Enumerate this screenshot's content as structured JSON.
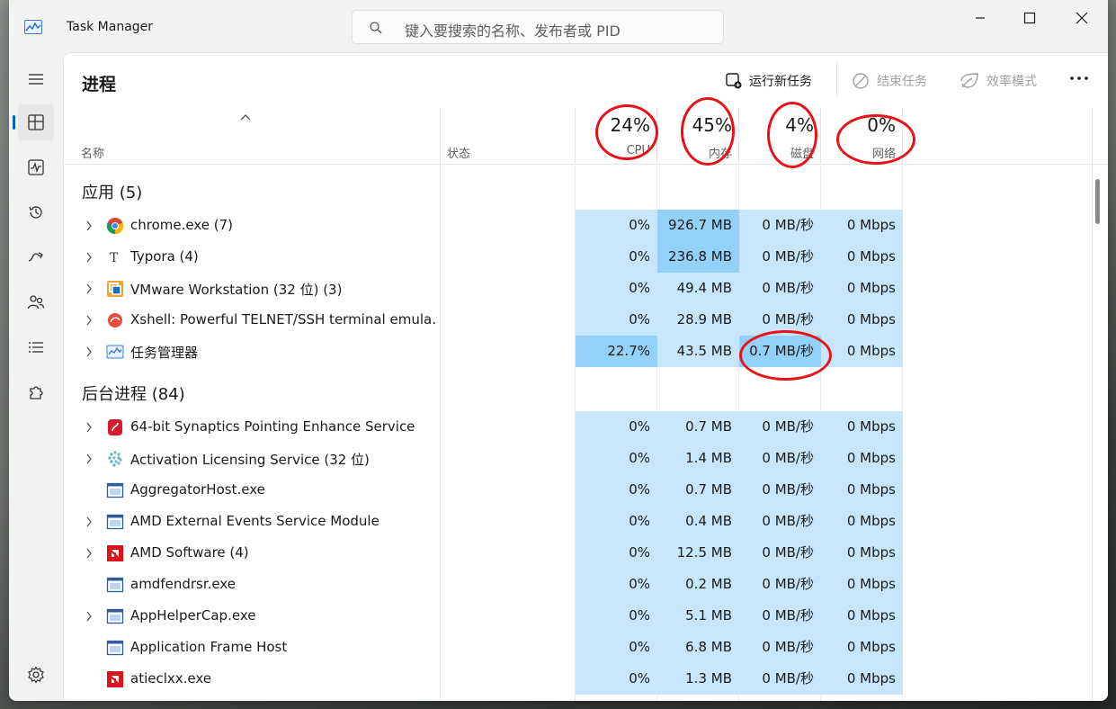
{
  "window": {
    "title": "Task Manager",
    "search_placeholder": "键入要搜索的名称、发布者或 PID"
  },
  "page": {
    "title": "进程",
    "commands": {
      "run_new_task": "运行新任务",
      "end_task": "结束任务",
      "efficiency_mode": "效率模式"
    }
  },
  "header": {
    "name": "名称",
    "status": "状态",
    "cpu_pct": "24%",
    "cpu_label": "CPU",
    "mem_pct": "45%",
    "mem_label": "内存",
    "disk_pct": "4%",
    "disk_label": "磁盘",
    "net_pct": "0%",
    "net_label": "网络"
  },
  "groups": {
    "apps": "应用 (5)",
    "background": "后台进程 (84)"
  },
  "apps": [
    {
      "name": "chrome.exe (7)",
      "icon": "chrome-icon",
      "cpu": "0%",
      "mem": "926.7 MB",
      "disk": "0 MB/秒",
      "net": "0 Mbps"
    },
    {
      "name": "Typora (4)",
      "icon": "typora-icon",
      "cpu": "0%",
      "mem": "236.8 MB",
      "disk": "0 MB/秒",
      "net": "0 Mbps"
    },
    {
      "name": "VMware Workstation (32 位) (3)",
      "icon": "vmware-icon",
      "cpu": "0%",
      "mem": "49.4 MB",
      "disk": "0 MB/秒",
      "net": "0 Mbps"
    },
    {
      "name": "Xshell: Powerful TELNET/SSH terminal emula...",
      "icon": "xshell-icon",
      "cpu": "0%",
      "mem": "28.9 MB",
      "disk": "0 MB/秒",
      "net": "0 Mbps"
    },
    {
      "name": "任务管理器",
      "icon": "task-manager-icon",
      "cpu": "22.7%",
      "mem": "43.5 MB",
      "disk": "0.7 MB/秒",
      "net": "0 Mbps"
    }
  ],
  "background": [
    {
      "name": "64-bit Synaptics Pointing Enhance Service",
      "icon": "synaptics-icon",
      "cpu": "0%",
      "mem": "0.7 MB",
      "disk": "0 MB/秒",
      "net": "0 Mbps"
    },
    {
      "name": "Activation Licensing Service (32 位)",
      "icon": "activation-icon",
      "cpu": "0%",
      "mem": "1.4 MB",
      "disk": "0 MB/秒",
      "net": "0 Mbps"
    },
    {
      "name": "AggregatorHost.exe",
      "icon": "app-window-icon",
      "cpu": "0%",
      "mem": "0.7 MB",
      "disk": "0 MB/秒",
      "net": "0 Mbps"
    },
    {
      "name": "AMD External Events Service Module",
      "icon": "app-window-icon",
      "cpu": "0%",
      "mem": "0.4 MB",
      "disk": "0 MB/秒",
      "net": "0 Mbps"
    },
    {
      "name": "AMD Software (4)",
      "icon": "amd-icon",
      "cpu": "0%",
      "mem": "12.5 MB",
      "disk": "0 MB/秒",
      "net": "0 Mbps"
    },
    {
      "name": "amdfendrsr.exe",
      "icon": "app-window-icon",
      "cpu": "0%",
      "mem": "0.2 MB",
      "disk": "0 MB/秒",
      "net": "0 Mbps"
    },
    {
      "name": "AppHelperCap.exe",
      "icon": "app-window-icon",
      "cpu": "0%",
      "mem": "5.1 MB",
      "disk": "0 MB/秒",
      "net": "0 Mbps"
    },
    {
      "name": "Application Frame Host",
      "icon": "app-window-icon",
      "cpu": "0%",
      "mem": "6.8 MB",
      "disk": "0 MB/秒",
      "net": "0 Mbps"
    },
    {
      "name": "atieclxx.exe",
      "icon": "amd-icon",
      "cpu": "0%",
      "mem": "1.3 MB",
      "disk": "0 MB/秒",
      "net": "0 Mbps"
    }
  ],
  "colors": {
    "accent": "#0067c0",
    "cell_light": "#c8e6fb",
    "cell_hot": "#94d1f8",
    "annotation_red": "#e8121a"
  }
}
